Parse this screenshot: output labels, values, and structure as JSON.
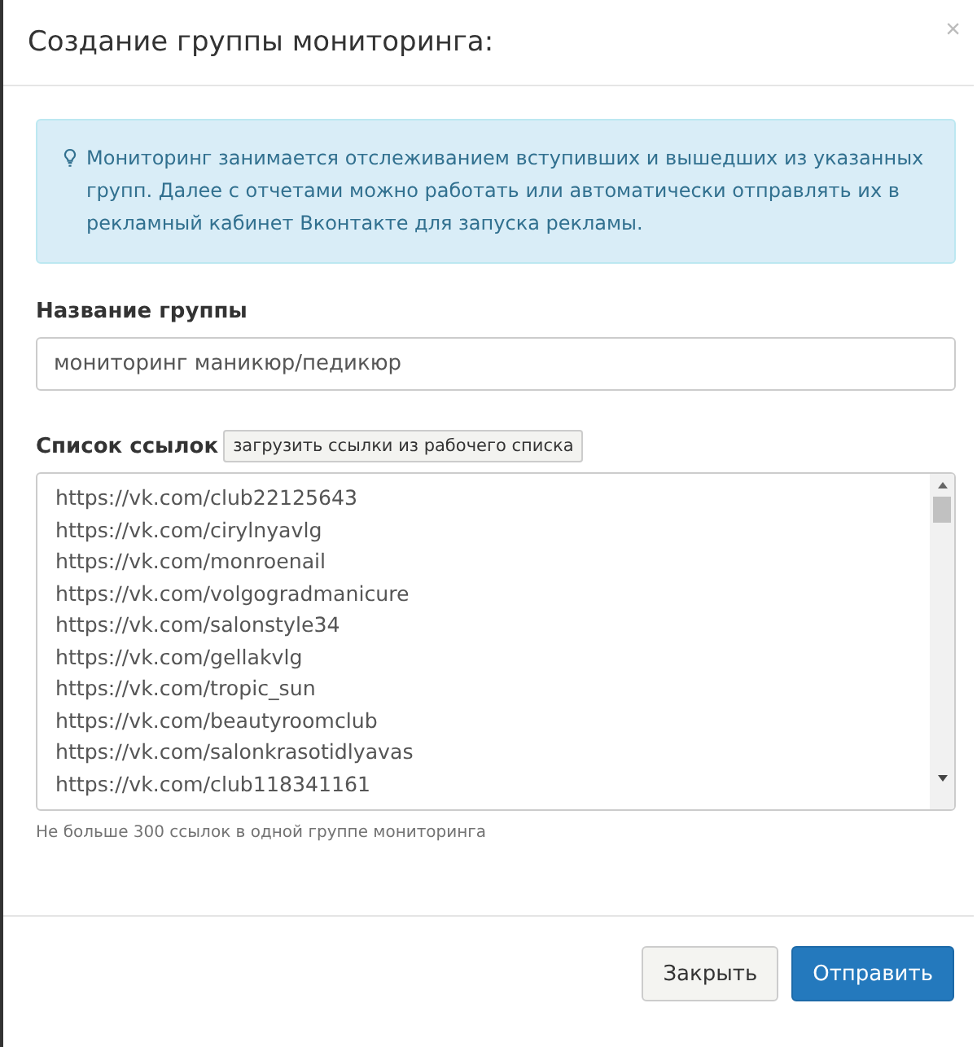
{
  "dialog": {
    "title": "Создание группы мониторинга:",
    "close": "×"
  },
  "info": "Мониторинг занимается отслеживанием вступивших и вышедших из указанных групп. Далее с отчетами можно работать или автоматически отправлять их в рекламный кабинет Вконтакте для запуска рекламы.",
  "group_name": {
    "label": "Название группы",
    "value": "мониторинг маникюр/педикюр"
  },
  "links": {
    "label": "Список ссылок",
    "load_button": "загрузить ссылки из рабочего списка",
    "lines": [
      "https://vk.com/club22125643",
      "https://vk.com/cirylnyavlg",
      "https://vk.com/monroenail",
      "https://vk.com/volgogradmanicure",
      "https://vk.com/salonstyle34",
      "https://vk.com/gellakvlg",
      "https://vk.com/tropic_sun",
      "https://vk.com/beautyroomclub",
      "https://vk.com/salonkrasotidlyavas",
      "https://vk.com/club118341161"
    ],
    "help": "Не больше 300 ссылок в одной группе мониторинга"
  },
  "buttons": [
    {
      "label": "Закрыть",
      "kind": "default"
    },
    {
      "label": "Отправить",
      "kind": "primary"
    }
  ]
}
